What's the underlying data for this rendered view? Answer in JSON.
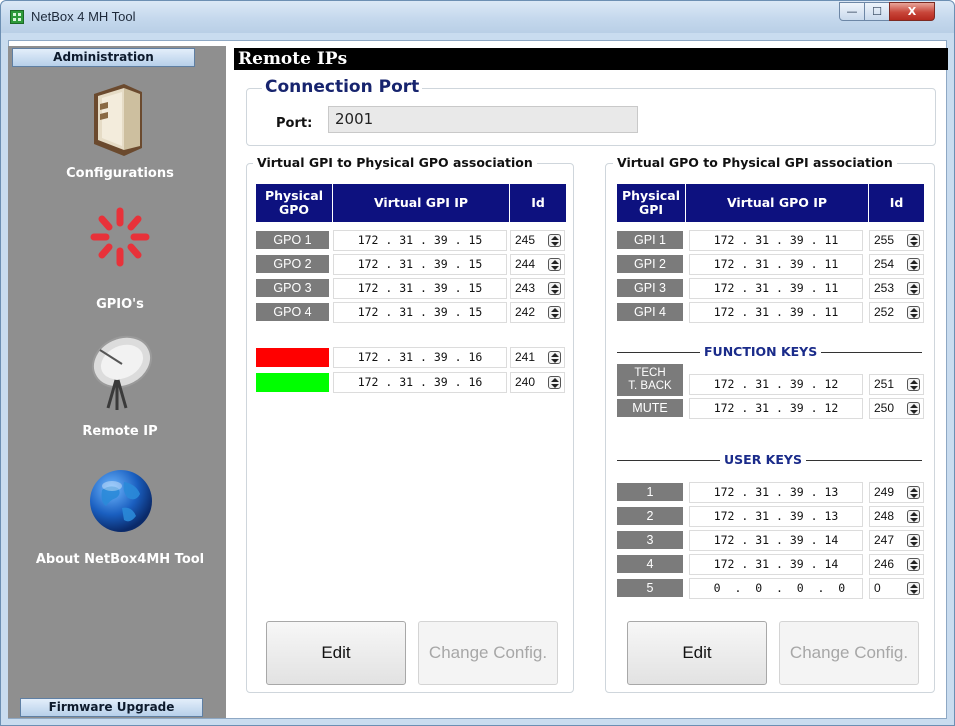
{
  "window": {
    "title": "NetBox 4 MH Tool",
    "min": "—",
    "max": "☐",
    "close": "X"
  },
  "sidebar": {
    "top_button": "Administration",
    "bottom_button": "Firmware Upgrade",
    "items": [
      {
        "label": "Configurations",
        "icon": "book-icon"
      },
      {
        "label": "GPIO's",
        "icon": "spinner-icon"
      },
      {
        "label": "Remote IP",
        "icon": "satellite-dish-icon"
      },
      {
        "label": "About NetBox4MH Tool",
        "icon": "globe-icon"
      }
    ]
  },
  "main": {
    "title": "Remote IPs",
    "connection": {
      "title": "Connection Port",
      "port_label": "Port:",
      "port_value": "2001"
    },
    "left": {
      "title": "Virtual GPI to Physical GPO association",
      "headers": {
        "physical": "Physical GPO",
        "ip": "Virtual  GPI  IP",
        "id": "Id"
      },
      "rows": [
        {
          "tag": "GPO 1",
          "ip": "172 . 31 . 39 . 15",
          "id": "245"
        },
        {
          "tag": "GPO 2",
          "ip": "172 . 31 . 39 . 15",
          "id": "244"
        },
        {
          "tag": "GPO 3",
          "ip": "172 . 31 . 39 . 15",
          "id": "243"
        },
        {
          "tag": "GPO 4",
          "ip": "172 . 31 . 39 . 15",
          "id": "242"
        }
      ],
      "color_rows": [
        {
          "color": "#ff0000",
          "ip": "172 . 31 . 39 . 16",
          "id": "241"
        },
        {
          "color": "#00ff00",
          "ip": "172 . 31 . 39 . 16",
          "id": "240"
        }
      ],
      "edit": "Edit",
      "change": "Change Config."
    },
    "right": {
      "title": "Virtual GPO to Physical GPI association",
      "headers": {
        "physical": "Physical GPI",
        "ip": "Virtual  GPO  IP",
        "id": "Id"
      },
      "rows": [
        {
          "tag": "GPI 1",
          "ip": "172 . 31 . 39 . 11",
          "id": "255"
        },
        {
          "tag": "GPI 2",
          "ip": "172 . 31 . 39 . 11",
          "id": "254"
        },
        {
          "tag": "GPI 3",
          "ip": "172 . 31 . 39 . 11",
          "id": "253"
        },
        {
          "tag": "GPI 4",
          "ip": "172 . 31 . 39 . 11",
          "id": "252"
        }
      ],
      "function_keys_label": "FUNCTION KEYS",
      "function_keys": [
        {
          "tag_line1": "TECH",
          "tag_line2": "T. BACK",
          "ip": "172 . 31 . 39 . 12",
          "id": "251"
        },
        {
          "tag": "MUTE",
          "ip": "172 . 31 . 39 . 12",
          "id": "250"
        }
      ],
      "user_keys_label": "USER KEYS",
      "user_keys": [
        {
          "tag": "1",
          "ip": "172 . 31 . 39 . 13",
          "id": "249"
        },
        {
          "tag": "2",
          "ip": "172 . 31 . 39 . 13",
          "id": "248"
        },
        {
          "tag": "3",
          "ip": "172 . 31 . 39 . 14",
          "id": "247"
        },
        {
          "tag": "4",
          "ip": "172 . 31 . 39 . 14",
          "id": "246"
        },
        {
          "tag": "5",
          "ip": " 0  .  0  .  0  .  0",
          "id": "0"
        }
      ],
      "edit": "Edit",
      "change": "Change Config."
    }
  }
}
